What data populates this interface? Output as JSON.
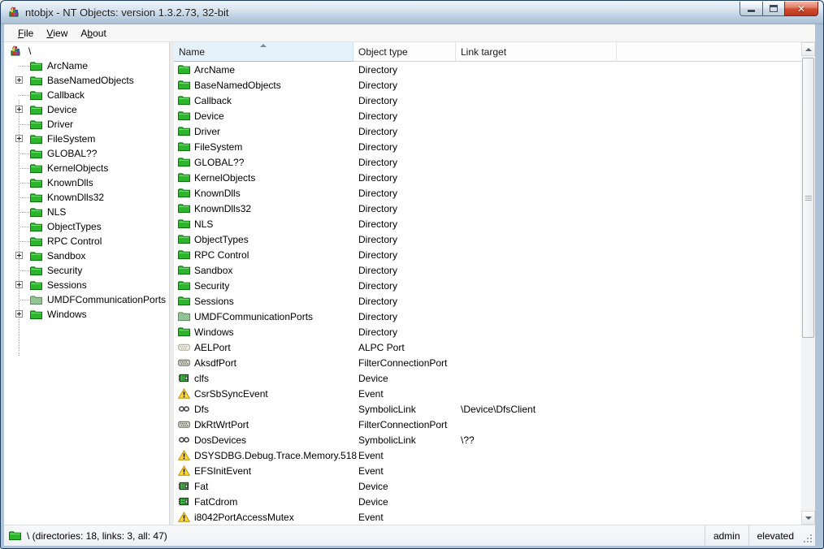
{
  "window": {
    "title": "ntobjx - NT Objects: version 1.3.2.73, 32-bit"
  },
  "menu": {
    "items": [
      {
        "pre": "",
        "key": "F",
        "rest": "ile"
      },
      {
        "pre": "",
        "key": "V",
        "rest": "iew"
      },
      {
        "pre": "A",
        "key": "b",
        "rest": "out"
      }
    ]
  },
  "tree": {
    "root_label": "\\",
    "items": [
      {
        "label": "ArcName",
        "expandable": false,
        "icon": "folder"
      },
      {
        "label": "BaseNamedObjects",
        "expandable": true,
        "icon": "folder"
      },
      {
        "label": "Callback",
        "expandable": false,
        "icon": "folder"
      },
      {
        "label": "Device",
        "expandable": true,
        "icon": "folder"
      },
      {
        "label": "Driver",
        "expandable": false,
        "icon": "folder"
      },
      {
        "label": "FileSystem",
        "expandable": true,
        "icon": "folder"
      },
      {
        "label": "GLOBAL??",
        "expandable": false,
        "icon": "folder"
      },
      {
        "label": "KernelObjects",
        "expandable": false,
        "icon": "folder"
      },
      {
        "label": "KnownDlls",
        "expandable": false,
        "icon": "folder"
      },
      {
        "label": "KnownDlls32",
        "expandable": false,
        "icon": "folder"
      },
      {
        "label": "NLS",
        "expandable": false,
        "icon": "folder"
      },
      {
        "label": "ObjectTypes",
        "expandable": false,
        "icon": "folder"
      },
      {
        "label": "RPC Control",
        "expandable": false,
        "icon": "folder"
      },
      {
        "label": "Sandbox",
        "expandable": true,
        "icon": "folder"
      },
      {
        "label": "Security",
        "expandable": false,
        "icon": "folder"
      },
      {
        "label": "Sessions",
        "expandable": true,
        "icon": "folder"
      },
      {
        "label": "UMDFCommunicationPorts",
        "expandable": false,
        "icon": "folder-restricted"
      },
      {
        "label": "Windows",
        "expandable": true,
        "icon": "folder"
      }
    ]
  },
  "list": {
    "columns": [
      "Name",
      "Object type",
      "Link target"
    ],
    "sort_column": "Name",
    "sort_direction": "ascending",
    "rows": [
      {
        "name": "ArcName",
        "type": "Directory",
        "target": "",
        "icon": "folder"
      },
      {
        "name": "BaseNamedObjects",
        "type": "Directory",
        "target": "",
        "icon": "folder"
      },
      {
        "name": "Callback",
        "type": "Directory",
        "target": "",
        "icon": "folder"
      },
      {
        "name": "Device",
        "type": "Directory",
        "target": "",
        "icon": "folder"
      },
      {
        "name": "Driver",
        "type": "Directory",
        "target": "",
        "icon": "folder"
      },
      {
        "name": "FileSystem",
        "type": "Directory",
        "target": "",
        "icon": "folder"
      },
      {
        "name": "GLOBAL??",
        "type": "Directory",
        "target": "",
        "icon": "folder"
      },
      {
        "name": "KernelObjects",
        "type": "Directory",
        "target": "",
        "icon": "folder"
      },
      {
        "name": "KnownDlls",
        "type": "Directory",
        "target": "",
        "icon": "folder"
      },
      {
        "name": "KnownDlls32",
        "type": "Directory",
        "target": "",
        "icon": "folder"
      },
      {
        "name": "NLS",
        "type": "Directory",
        "target": "",
        "icon": "folder"
      },
      {
        "name": "ObjectTypes",
        "type": "Directory",
        "target": "",
        "icon": "folder"
      },
      {
        "name": "RPC Control",
        "type": "Directory",
        "target": "",
        "icon": "folder"
      },
      {
        "name": "Sandbox",
        "type": "Directory",
        "target": "",
        "icon": "folder"
      },
      {
        "name": "Security",
        "type": "Directory",
        "target": "",
        "icon": "folder"
      },
      {
        "name": "Sessions",
        "type": "Directory",
        "target": "",
        "icon": "folder"
      },
      {
        "name": "UMDFCommunicationPorts",
        "type": "Directory",
        "target": "",
        "icon": "folder-restricted"
      },
      {
        "name": "Windows",
        "type": "Directory",
        "target": "",
        "icon": "folder"
      },
      {
        "name": "AELPort",
        "type": "ALPC Port",
        "target": "",
        "icon": "alpc-port"
      },
      {
        "name": "AksdfPort",
        "type": "FilterConnectionPort",
        "target": "",
        "icon": "filter-port"
      },
      {
        "name": "clfs",
        "type": "Device",
        "target": "",
        "icon": "device"
      },
      {
        "name": "CsrSbSyncEvent",
        "type": "Event",
        "target": "",
        "icon": "event"
      },
      {
        "name": "Dfs",
        "type": "SymbolicLink",
        "target": "\\Device\\DfsClient",
        "icon": "symlink"
      },
      {
        "name": "DkRtWrtPort",
        "type": "FilterConnectionPort",
        "target": "",
        "icon": "filter-port"
      },
      {
        "name": "DosDevices",
        "type": "SymbolicLink",
        "target": "\\??",
        "icon": "symlink"
      },
      {
        "name": "DSYSDBG.Debug.Trace.Memory.518",
        "type": "Event",
        "target": "",
        "icon": "event"
      },
      {
        "name": "EFSInitEvent",
        "type": "Event",
        "target": "",
        "icon": "event"
      },
      {
        "name": "Fat",
        "type": "Device",
        "target": "",
        "icon": "device"
      },
      {
        "name": "FatCdrom",
        "type": "Device",
        "target": "",
        "icon": "device"
      },
      {
        "name": "i8042PortAccessMutex",
        "type": "Event",
        "target": "",
        "icon": "event"
      }
    ]
  },
  "status": {
    "left": "\\ (directories: 18, links: 3, all: 47)",
    "panes": [
      "admin",
      "elevated"
    ]
  },
  "colors": {
    "folder_green": "#2db52d",
    "event_yellow": "#ffd83a",
    "close_button_red": "#cf4a2d",
    "titlebar_top": "#eef3f9",
    "titlebar_bottom": "#aabfd5",
    "sorted_header_blue": "#e6f2fb"
  }
}
